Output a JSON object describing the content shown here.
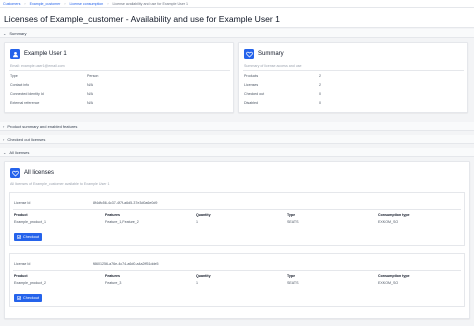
{
  "breadcrumb": {
    "items": [
      "Customers",
      "Example_customer",
      "License consumption",
      "License availability and use for Example User 1"
    ]
  },
  "page": {
    "title": "Licenses of Example_customer - Availability and use for Example User 1"
  },
  "sections": {
    "summary": "Summary",
    "product_summary": "Product summary and enabled features",
    "checked_out": "Checked out licenses",
    "all_licenses": "All licenses"
  },
  "user_card": {
    "title": "Example User 1",
    "subtitle": "Email: example.user1@email.com",
    "rows": [
      {
        "label": "Type",
        "value": "Person"
      },
      {
        "label": "Contact info",
        "value": "N/A"
      },
      {
        "label": "Connected identity Id",
        "value": "N/A"
      },
      {
        "label": "External reference",
        "value": "N/A"
      }
    ]
  },
  "summary_card": {
    "title": "Summary",
    "subtitle": "Summary of license access and use",
    "rows": [
      {
        "label": "Products",
        "value": "2"
      },
      {
        "label": "Licenses",
        "value": "2"
      },
      {
        "label": "Checked out",
        "value": "0"
      },
      {
        "label": "Disabled",
        "value": "0"
      }
    ]
  },
  "all_licenses": {
    "title": "All licenses",
    "subtitle": "All licenses of Example_customer available to Example User 1",
    "headers": {
      "product": "Product",
      "features": "Features",
      "quantity": "Quantity",
      "type": "Type",
      "consumption": "Consumption type"
    },
    "license_id_label": "License Id",
    "checkout_label": "Checkout",
    "licenses": [
      {
        "license_id": "8f4dfc56-4c37-4f7f-a6d5-37e3d0a6e0d9",
        "product": "Example_product_1",
        "features": "Feature_1,Feature_2",
        "quantity": "1",
        "type": "SEATS",
        "consumption": "EXKOM_SO"
      },
      {
        "license_id": "f8601256-a76e-4c74-a6d0-a4a2ff51dde5",
        "product": "Example_product_2",
        "features": "Feature_3",
        "quantity": "1",
        "type": "SEATS",
        "consumption": "EXKOM_SO"
      }
    ]
  },
  "colors": {
    "accent": "#2563eb",
    "background": "#f3f4f6",
    "card": "#ffffff"
  }
}
